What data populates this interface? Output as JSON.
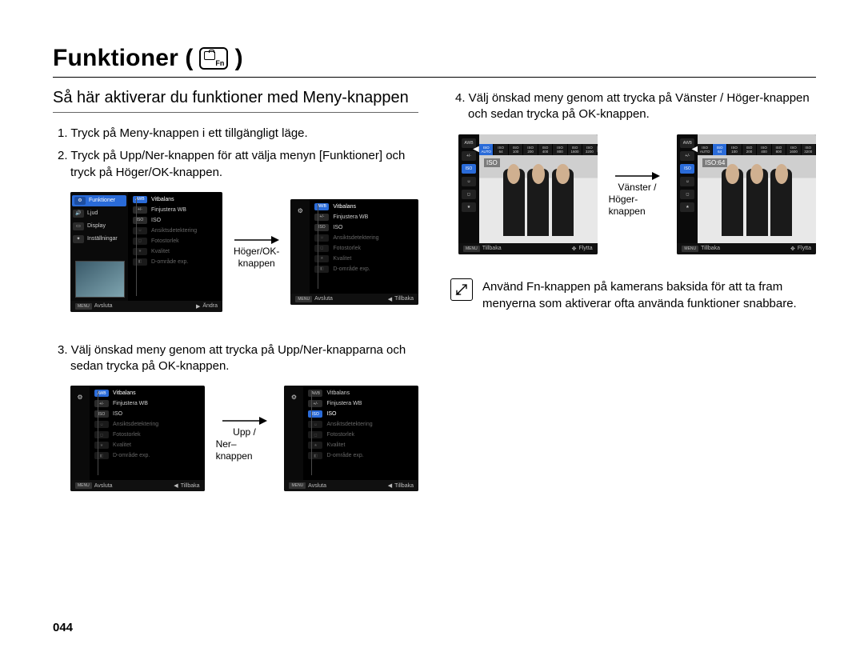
{
  "page_number": "044",
  "title": "Funktioner",
  "fn_label": "Fn",
  "subheading": "Så här aktiverar du funktioner med Meny-knappen",
  "steps": {
    "s1": "1. Tryck på Meny-knappen i ett tillgängligt läge.",
    "s2": "2. Tryck på Upp/Ner-knappen för att välja menyn [Funktioner] och tryck på Höger/OK-knappen.",
    "s3": "3. Välj önskad meny genom att trycka på Upp/Ner-knapparna och sedan trycka på OK-knappen.",
    "s4": "4. Välj önskad meny genom att trycka på Vänster / Höger-knappen och sedan trycka på OK-knappen."
  },
  "arrows": {
    "a1_line1": "Höger/OK-",
    "a1_line2": "knappen",
    "a2_line1": "Upp /",
    "a2_line2": "Ner–knappen",
    "a3_line1": "Vänster /",
    "a3_line2": "Höger-knappen"
  },
  "note": "Använd Fn-knappen på kamerans baksida för att ta fram menyerna som aktiverar ofta använda funktioner snabbare.",
  "screens": {
    "left_menu": {
      "funktioner": "Funktioner",
      "ljud": "Ljud",
      "display": "Display",
      "installningar": "Inställningar"
    },
    "timeline": {
      "vitbalans": "Vitbalans",
      "finjustera": "Finjustera WB",
      "iso": "ISO",
      "ansikts": "Ansiktsdetektering",
      "fotost": "Fotostorlek",
      "kvalitet": "Kvalitet",
      "domrade": "D-område exp."
    },
    "footer": {
      "avsluta": "Avsluta",
      "andra": "Ändra",
      "tillbaka": "Tillbaka",
      "flytta": "Flytta",
      "menu": "MENU"
    },
    "iso": {
      "label_plain": "ISO",
      "label_value": "ISO:64",
      "opts": [
        "AUTO",
        "64",
        "100",
        "200",
        "400",
        "800",
        "1600",
        "3200"
      ]
    },
    "icon_tags": {
      "awb": "AWB",
      "finj": "+/-",
      "iso": "ISO",
      "face": "☺",
      "size": "◻",
      "qual": "★",
      "dr": "◧"
    }
  }
}
